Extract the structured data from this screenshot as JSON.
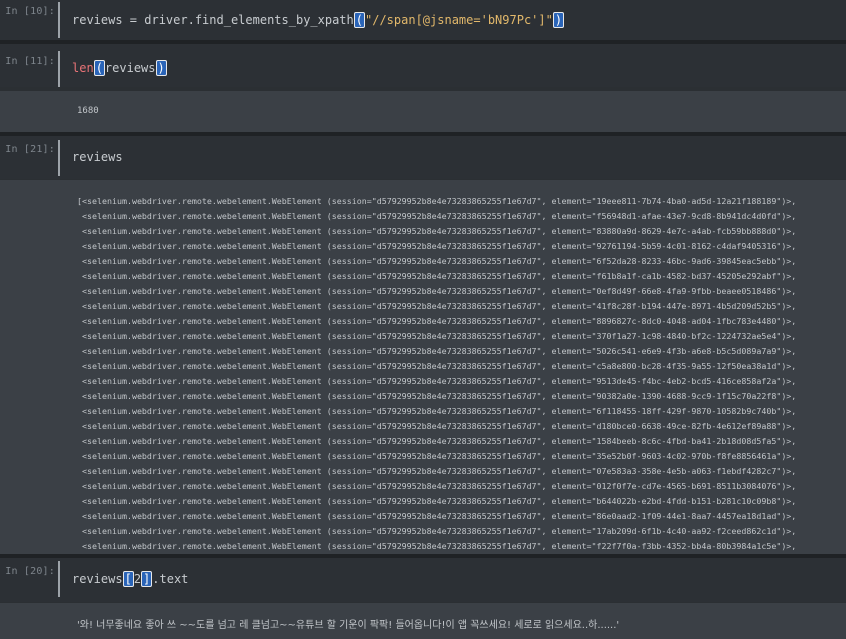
{
  "cells": [
    {
      "prompt": "In [10]:",
      "code_pre": "reviews = driver.find_elements_by_xpath",
      "code_str": "\"//span[@jsname='bN97Pc']\""
    },
    {
      "prompt": "In [11]:",
      "code_fn": "len",
      "code_arg": "reviews",
      "output": "1680"
    },
    {
      "prompt": "In [21]:",
      "code": "reviews"
    },
    {
      "prompt": "In [20]:",
      "code_pre": "reviews",
      "code_idx": "2",
      "code_post": ".text",
      "output": "'와! 너무좋네요 좋아 쓰 ~~도를 넘고 레 클넘고~~유튜브 할 기운이 팍팍! 들어옵니다!이 앱 꼭쓰세요! 세로로 읽으세요..하......'"
    }
  ],
  "webelements": {
    "first_prefix": "[<selenium.webdriver.remote.webelement.WebElement (session=\"d57929952b8e4e73283865255f1e67d7\", element=\"",
    "prefix": " <selenium.webdriver.remote.webelement.WebElement (session=\"d57929952b8e4e73283865255f1e67d7\", element=\"",
    "suffix": "\")>,",
    "ids": [
      "19eee811-7b74-4ba0-ad5d-12a21f188189",
      "f56948d1-afae-43e7-9cd8-8b941dc4d0fd",
      "83880a9d-8629-4e7c-a4ab-fcb59bb888d0",
      "92761194-5b59-4c01-8162-c4daf9405316",
      "6f52da28-8233-46bc-9ad6-39845eac5ebb",
      "f61b8a1f-ca1b-4582-bd37-45205e292abf",
      "0ef8d49f-66e8-4fa9-9fbb-beaee0518486",
      "41f8c28f-b194-447e-8971-4b5d209d52b5",
      "8896827c-8dc0-4048-ad04-1fbc783e4480",
      "370f1a27-1c98-4840-bf2c-1224732ae5e4",
      "5026c541-e6e9-4f3b-a6e8-b5c5d089a7a9",
      "c5a8e800-bc28-4f35-9a55-12f50ea38a1d",
      "9513de45-f4bc-4eb2-bcd5-416ce858af2a",
      "90382a0e-1390-4688-9cc9-1f15c70a22f8",
      "6f118455-18ff-429f-9870-10582b9c740b",
      "d180bce0-6638-49ce-82fb-4e612ef89a88",
      "1584beeb-8c6c-4fbd-ba41-2b18d08d5fa5",
      "35e52b0f-9603-4c02-970b-f8fe8856461a",
      "07e583a3-358e-4e5b-a063-f1ebdf4282c7",
      "012f0f7e-cd7e-4565-b691-8511b3084076",
      "b644022b-e2bd-4fdd-b151-b281c10c09b8",
      "86e0aad2-1f09-44e1-8aa7-4457ea18d1ad",
      "17ab209d-6f1b-4c40-aa92-f2ceed862c1d",
      "f22f7f0a-f3bb-4352-bb4a-80b3984a1c5e"
    ]
  }
}
